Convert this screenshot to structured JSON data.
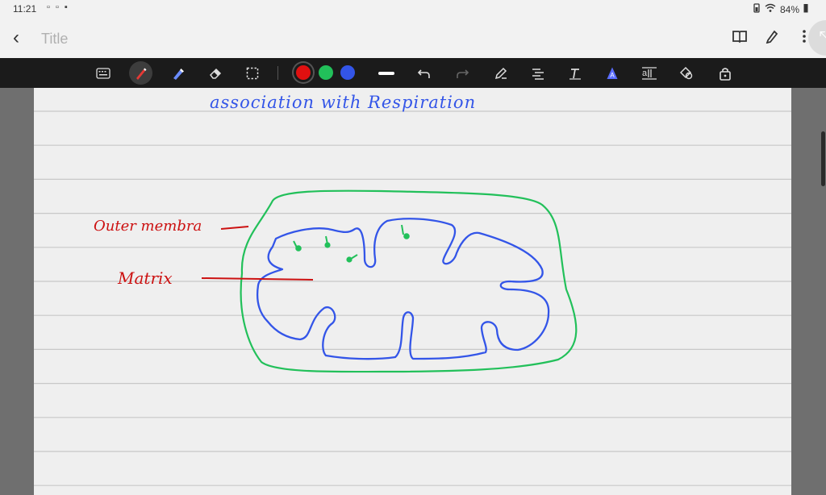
{
  "status_bar": {
    "time": "11:21",
    "notification_icons": "▫ ▫ ▪",
    "battery_percent": "84%"
  },
  "title_bar": {
    "back_icon": "‹",
    "title": "Title",
    "actions": [
      "book-icon",
      "pen-icon",
      "more-vertical-icon"
    ],
    "collapse_icon": "⤡"
  },
  "toolbar": {
    "tools": [
      "keyboard-icon",
      "pen-tool-icon",
      "highlighter-icon",
      "eraser-icon",
      "selection-icon"
    ],
    "active_tool": "pen",
    "colors": [
      "#e01010",
      "#22c05a",
      "#3355e8"
    ],
    "selected_color": "#e01010",
    "actions": [
      "stroke-width-icon",
      "undo-icon",
      "redo-icon",
      "shape-pen-icon",
      "text-align-icon",
      "text-tool-icon",
      "ai-icon",
      "text-box-icon",
      "shapes-icon",
      "lock-icon"
    ]
  },
  "note": {
    "heading": "association   with    Respiration",
    "label_outer": "Outer membra",
    "label_matrix": "Matrix",
    "ink_colors": {
      "blue": "#3355e8",
      "green": "#22c05a",
      "red": "#cc1111"
    },
    "ruled_line_color": "#c8c8c8"
  }
}
